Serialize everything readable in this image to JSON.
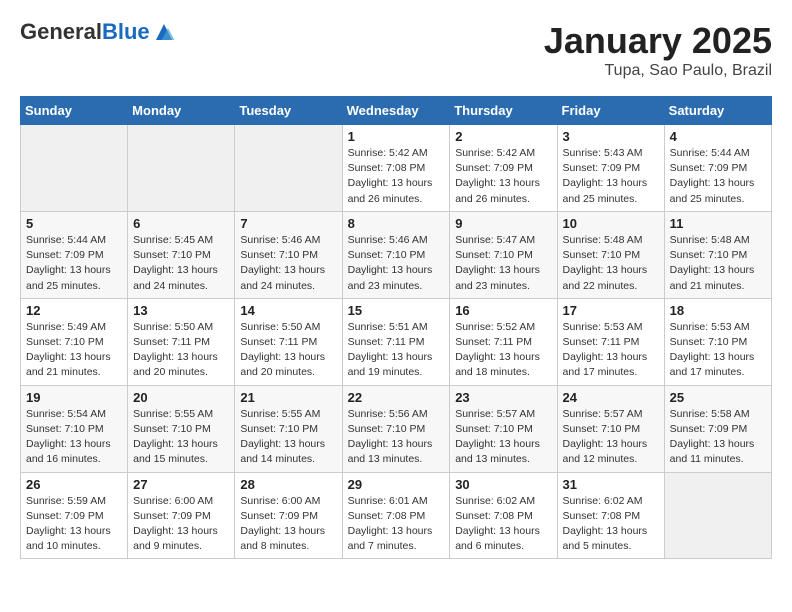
{
  "header": {
    "logo_general": "General",
    "logo_blue": "Blue",
    "month_title": "January 2025",
    "location": "Tupa, Sao Paulo, Brazil"
  },
  "weekdays": [
    "Sunday",
    "Monday",
    "Tuesday",
    "Wednesday",
    "Thursday",
    "Friday",
    "Saturday"
  ],
  "weeks": [
    [
      {
        "day": "",
        "info": ""
      },
      {
        "day": "",
        "info": ""
      },
      {
        "day": "",
        "info": ""
      },
      {
        "day": "1",
        "info": "Sunrise: 5:42 AM\nSunset: 7:08 PM\nDaylight: 13 hours\nand 26 minutes."
      },
      {
        "day": "2",
        "info": "Sunrise: 5:42 AM\nSunset: 7:09 PM\nDaylight: 13 hours\nand 26 minutes."
      },
      {
        "day": "3",
        "info": "Sunrise: 5:43 AM\nSunset: 7:09 PM\nDaylight: 13 hours\nand 25 minutes."
      },
      {
        "day": "4",
        "info": "Sunrise: 5:44 AM\nSunset: 7:09 PM\nDaylight: 13 hours\nand 25 minutes."
      }
    ],
    [
      {
        "day": "5",
        "info": "Sunrise: 5:44 AM\nSunset: 7:09 PM\nDaylight: 13 hours\nand 25 minutes."
      },
      {
        "day": "6",
        "info": "Sunrise: 5:45 AM\nSunset: 7:10 PM\nDaylight: 13 hours\nand 24 minutes."
      },
      {
        "day": "7",
        "info": "Sunrise: 5:46 AM\nSunset: 7:10 PM\nDaylight: 13 hours\nand 24 minutes."
      },
      {
        "day": "8",
        "info": "Sunrise: 5:46 AM\nSunset: 7:10 PM\nDaylight: 13 hours\nand 23 minutes."
      },
      {
        "day": "9",
        "info": "Sunrise: 5:47 AM\nSunset: 7:10 PM\nDaylight: 13 hours\nand 23 minutes."
      },
      {
        "day": "10",
        "info": "Sunrise: 5:48 AM\nSunset: 7:10 PM\nDaylight: 13 hours\nand 22 minutes."
      },
      {
        "day": "11",
        "info": "Sunrise: 5:48 AM\nSunset: 7:10 PM\nDaylight: 13 hours\nand 21 minutes."
      }
    ],
    [
      {
        "day": "12",
        "info": "Sunrise: 5:49 AM\nSunset: 7:10 PM\nDaylight: 13 hours\nand 21 minutes."
      },
      {
        "day": "13",
        "info": "Sunrise: 5:50 AM\nSunset: 7:11 PM\nDaylight: 13 hours\nand 20 minutes."
      },
      {
        "day": "14",
        "info": "Sunrise: 5:50 AM\nSunset: 7:11 PM\nDaylight: 13 hours\nand 20 minutes."
      },
      {
        "day": "15",
        "info": "Sunrise: 5:51 AM\nSunset: 7:11 PM\nDaylight: 13 hours\nand 19 minutes."
      },
      {
        "day": "16",
        "info": "Sunrise: 5:52 AM\nSunset: 7:11 PM\nDaylight: 13 hours\nand 18 minutes."
      },
      {
        "day": "17",
        "info": "Sunrise: 5:53 AM\nSunset: 7:11 PM\nDaylight: 13 hours\nand 17 minutes."
      },
      {
        "day": "18",
        "info": "Sunrise: 5:53 AM\nSunset: 7:10 PM\nDaylight: 13 hours\nand 17 minutes."
      }
    ],
    [
      {
        "day": "19",
        "info": "Sunrise: 5:54 AM\nSunset: 7:10 PM\nDaylight: 13 hours\nand 16 minutes."
      },
      {
        "day": "20",
        "info": "Sunrise: 5:55 AM\nSunset: 7:10 PM\nDaylight: 13 hours\nand 15 minutes."
      },
      {
        "day": "21",
        "info": "Sunrise: 5:55 AM\nSunset: 7:10 PM\nDaylight: 13 hours\nand 14 minutes."
      },
      {
        "day": "22",
        "info": "Sunrise: 5:56 AM\nSunset: 7:10 PM\nDaylight: 13 hours\nand 13 minutes."
      },
      {
        "day": "23",
        "info": "Sunrise: 5:57 AM\nSunset: 7:10 PM\nDaylight: 13 hours\nand 13 minutes."
      },
      {
        "day": "24",
        "info": "Sunrise: 5:57 AM\nSunset: 7:10 PM\nDaylight: 13 hours\nand 12 minutes."
      },
      {
        "day": "25",
        "info": "Sunrise: 5:58 AM\nSunset: 7:09 PM\nDaylight: 13 hours\nand 11 minutes."
      }
    ],
    [
      {
        "day": "26",
        "info": "Sunrise: 5:59 AM\nSunset: 7:09 PM\nDaylight: 13 hours\nand 10 minutes."
      },
      {
        "day": "27",
        "info": "Sunrise: 6:00 AM\nSunset: 7:09 PM\nDaylight: 13 hours\nand 9 minutes."
      },
      {
        "day": "28",
        "info": "Sunrise: 6:00 AM\nSunset: 7:09 PM\nDaylight: 13 hours\nand 8 minutes."
      },
      {
        "day": "29",
        "info": "Sunrise: 6:01 AM\nSunset: 7:08 PM\nDaylight: 13 hours\nand 7 minutes."
      },
      {
        "day": "30",
        "info": "Sunrise: 6:02 AM\nSunset: 7:08 PM\nDaylight: 13 hours\nand 6 minutes."
      },
      {
        "day": "31",
        "info": "Sunrise: 6:02 AM\nSunset: 7:08 PM\nDaylight: 13 hours\nand 5 minutes."
      },
      {
        "day": "",
        "info": ""
      }
    ]
  ]
}
